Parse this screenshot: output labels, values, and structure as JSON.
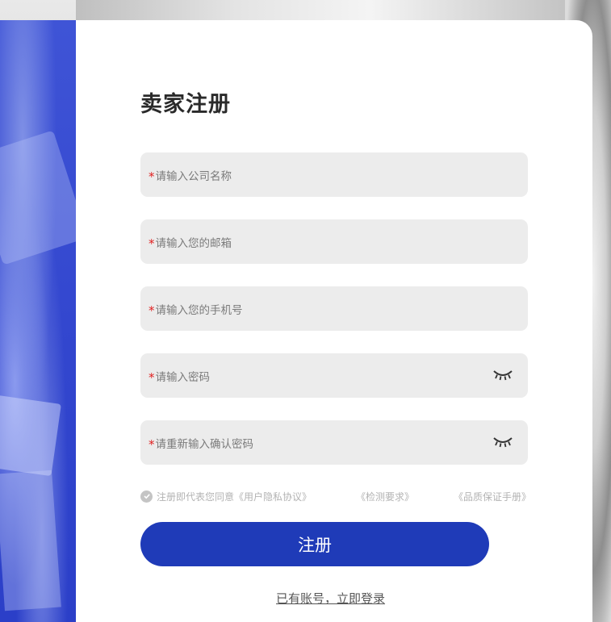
{
  "page": {
    "title": "卖家注册"
  },
  "form": {
    "required_mark": "*",
    "fields": [
      {
        "placeholder": "请输入公司名称",
        "has_eye": false
      },
      {
        "placeholder": "请输入您的邮箱",
        "has_eye": false
      },
      {
        "placeholder": "请输入您的手机号",
        "has_eye": false
      },
      {
        "placeholder": "请输入密码",
        "has_eye": true
      },
      {
        "placeholder": "请重新输入确认密码",
        "has_eye": true
      }
    ],
    "agreement": {
      "text": "注册即代表您同意《用户隐私协议》",
      "link_inspection": "《检测要求》",
      "link_quality": "《品质保证手册》",
      "checked": true
    },
    "submit_label": "注册",
    "login_link": "已有账号，立即登录"
  },
  "colors": {
    "accent": "#1f3bb8",
    "left_panel": "#3347cf",
    "field_bg": "#ececec",
    "required": "#e02020"
  },
  "icons": {
    "eye": "eye-closed-icon",
    "check": "check-circle-icon"
  }
}
